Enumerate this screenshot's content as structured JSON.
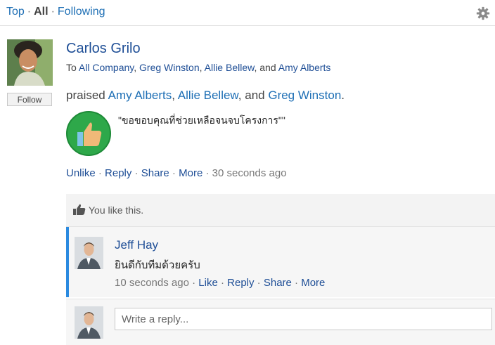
{
  "nav": {
    "top": "Top",
    "all": "All",
    "following": "Following",
    "sep": "·"
  },
  "post": {
    "author": "Carlos Grilo",
    "follow_label": "Follow",
    "to_prefix": "To",
    "recipients": [
      "All Company",
      "Greg Winston",
      "Allie Bellew",
      "Amy Alberts"
    ],
    "to_and": "and",
    "praised_prefix": "praised",
    "praised_people": [
      "Amy Alberts",
      "Allie Bellew",
      "Greg Winston"
    ],
    "praised_and": "and",
    "quote": "\"ขอขอบคุณที่ช่วยเหลือจนจบโครงการ\"\"",
    "actions": {
      "unlike": "Unlike",
      "reply": "Reply",
      "share": "Share",
      "more": "More",
      "time": "30 seconds ago"
    }
  },
  "likes": {
    "text": "You like this."
  },
  "reply": {
    "author": "Jeff Hay",
    "text": "ยินดีกับทีมด้วยครับ",
    "time": "10 seconds ago",
    "actions": {
      "like": "Like",
      "reply": "Reply",
      "share": "Share",
      "more": "More"
    }
  },
  "write_reply": {
    "placeholder": "Write a reply..."
  },
  "colors": {
    "link": "#1e4e96",
    "accent": "#2a8ae0",
    "badge_green": "#2ea84a"
  }
}
